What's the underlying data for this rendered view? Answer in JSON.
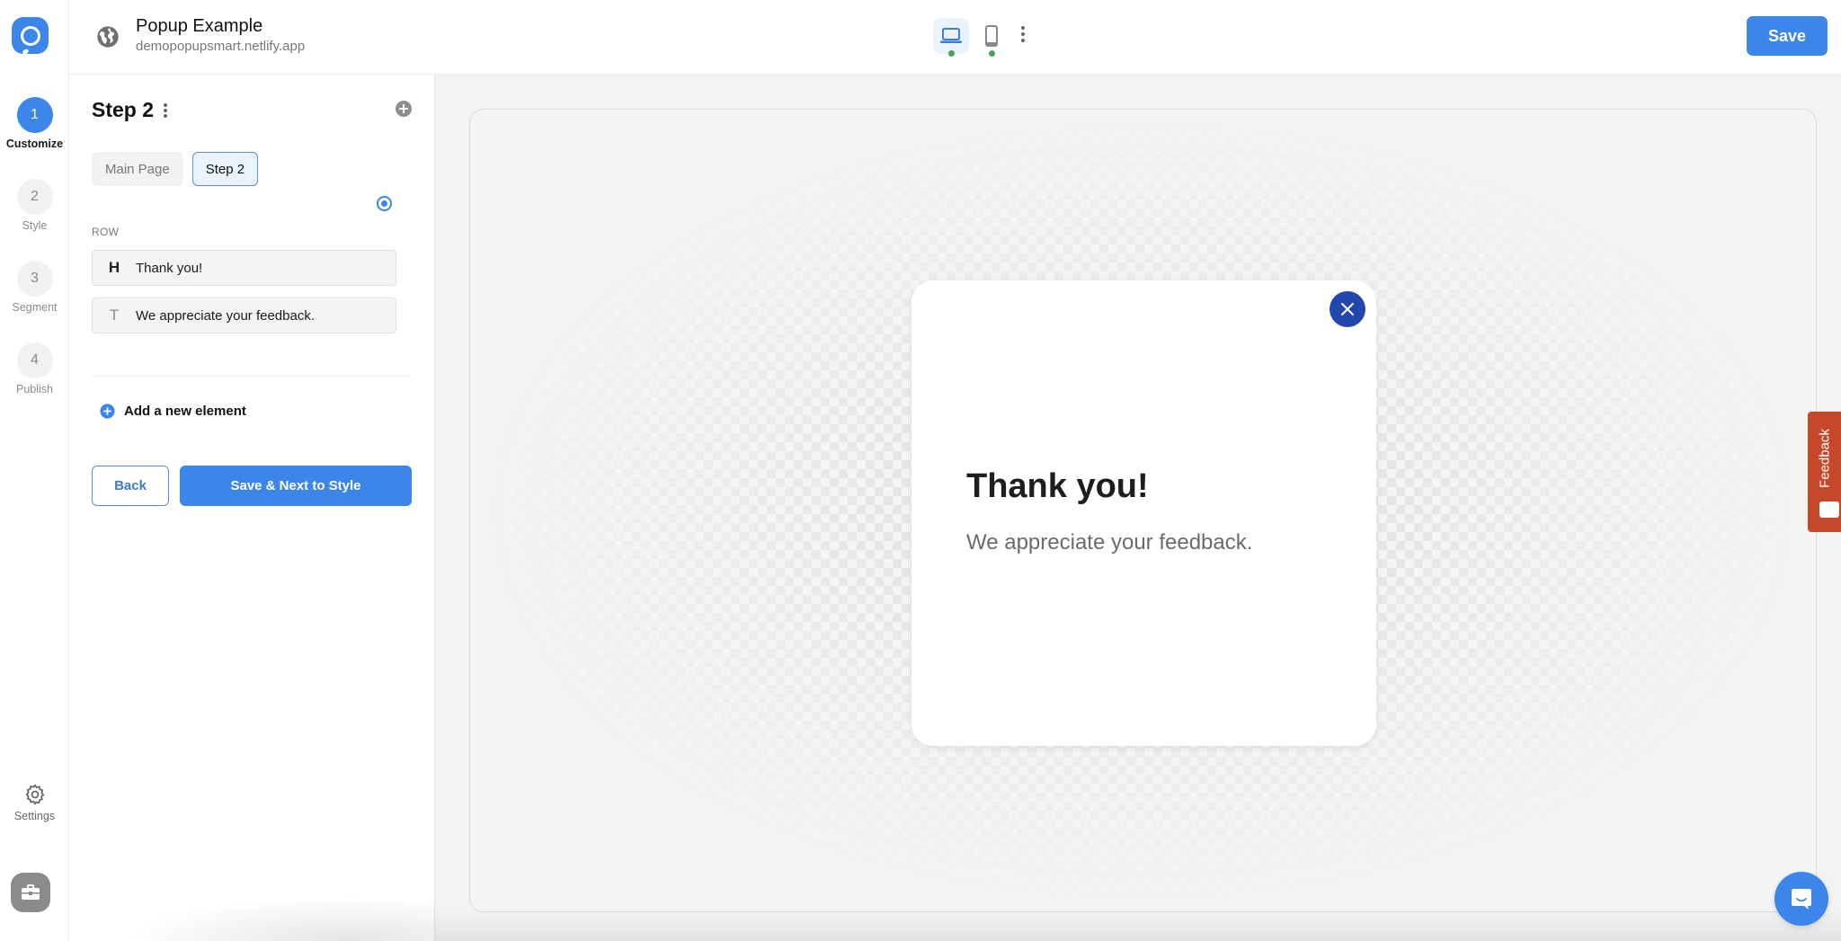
{
  "app": {
    "project_title": "Popup Example",
    "project_url": "demopopupsmart.netlify.app",
    "save_label": "Save"
  },
  "rail": {
    "steps": [
      {
        "number": "1",
        "label": "Customize",
        "active": true
      },
      {
        "number": "2",
        "label": "Style",
        "active": false
      },
      {
        "number": "3",
        "label": "Segment",
        "active": false
      },
      {
        "number": "4",
        "label": "Publish",
        "active": false
      }
    ],
    "settings_label": "Settings"
  },
  "toolbar": {
    "devices": [
      {
        "name": "desktop",
        "icon": "laptop-icon",
        "selected": true,
        "status": "active"
      },
      {
        "name": "mobile",
        "icon": "mobile-icon",
        "selected": false,
        "status": "active"
      }
    ]
  },
  "panel": {
    "title": "Step 2",
    "tabs": [
      {
        "label": "Main Page",
        "active": false
      },
      {
        "label": "Step 2",
        "active": true
      }
    ],
    "row_label": "ROW",
    "elements": [
      {
        "type": "heading",
        "icon_glyph": "H",
        "text": "Thank you!"
      },
      {
        "type": "text",
        "icon_glyph": "T",
        "text": "We appreciate your feedback."
      }
    ],
    "add_element_label": "Add a new element",
    "back_label": "Back",
    "next_label": "Save & Next to Style"
  },
  "preview": {
    "popup_title": "Thank you!",
    "popup_text": "We appreciate your feedback.",
    "close_color": "#2147ad"
  },
  "widgets": {
    "feedback_label": "Feedback",
    "feedback_color": "#c5482a",
    "chat_color": "#3b86e8"
  },
  "colors": {
    "accent": "#3b86e8"
  }
}
